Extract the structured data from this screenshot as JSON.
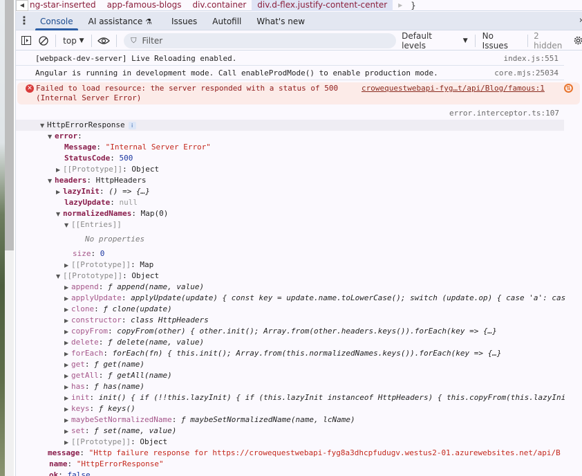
{
  "breadcrumbs": {
    "items": [
      "ng-star-inserted",
      "app-famous-blogs",
      "div.container",
      "div.d-flex.justify-content-center"
    ],
    "selected_index": 3,
    "trailing": "}"
  },
  "tabs": [
    {
      "label": "Console",
      "active": true
    },
    {
      "label": "AI assistance",
      "icon": "flask-icon"
    },
    {
      "label": "Issues"
    },
    {
      "label": "Autofill"
    },
    {
      "label": "What's new"
    }
  ],
  "toolbar": {
    "context": "top",
    "filter_placeholder": "Filter",
    "levels": "Default levels",
    "issues": "No Issues",
    "hidden": "2 hidden"
  },
  "console": {
    "messages": [
      {
        "text": "[webpack-dev-server] Live Reloading enabled.",
        "source": "index.js:551"
      },
      {
        "text": "Angular is running in development mode. Call enableProdMode() to enable production mode.",
        "source": "core.mjs:25034"
      }
    ],
    "error": {
      "line1": "Failed to load resource: the server responded with a status of 500",
      "line2": "(Internal Server Error)",
      "link": "crowequestwebapi-fyg…t/api/Blog/famous:1"
    },
    "log_source": "error.interceptor.ts:107",
    "tree": {
      "root": "HttpErrorResponse",
      "error_key": "error",
      "message_key": "Message",
      "message_val": "\"Internal Server Error\"",
      "status_key": "StatusCode",
      "status_val": "500",
      "proto_key": "[[Prototype]]",
      "proto_object": "Object",
      "proto_map": "Map",
      "headers_key": "headers",
      "headers_val": "HttpHeaders",
      "lazyinit_key": "lazyInit",
      "lazyinit_val": "() => {…}",
      "lazyupdate_key": "lazyUpdate",
      "lazyupdate_val": "null",
      "normnames_key": "normalizedNames",
      "normnames_val": "Map(0)",
      "entries_key": "[[Entries]]",
      "no_props": "No properties",
      "size_key": "size",
      "size_val": "0",
      "methods": [
        {
          "key": "append",
          "val": "ƒ append(name, value)"
        },
        {
          "key": "applyUpdate",
          "val": "applyUpdate(update) { const key = update.name.toLowerCase(); switch (update.op) { case 'a': cas"
        },
        {
          "key": "clone",
          "val": "ƒ clone(update)"
        },
        {
          "key": "constructor",
          "val": "class HttpHeaders"
        },
        {
          "key": "copyFrom",
          "val": "copyFrom(other) { other.init(); Array.from(other.headers.keys()).forEach(key => {…}"
        },
        {
          "key": "delete",
          "val": "ƒ delete(name, value)"
        },
        {
          "key": "forEach",
          "val": "forEach(fn) { this.init(); Array.from(this.normalizedNames.keys()).forEach(key => {…}"
        },
        {
          "key": "get",
          "val": "ƒ get(name)"
        },
        {
          "key": "getAll",
          "val": "ƒ getAll(name)"
        },
        {
          "key": "has",
          "val": "ƒ has(name)"
        },
        {
          "key": "init",
          "val": "init() { if (!!this.lazyInit) { if (this.lazyInit instanceof HttpHeaders) { this.copyFrom(this.lazyIni"
        },
        {
          "key": "keys",
          "val": "ƒ keys()"
        },
        {
          "key": "maybeSetNormalizedName",
          "val": "ƒ maybeSetNormalizedName(name, lcName)"
        },
        {
          "key": "set",
          "val": "ƒ set(name, value)"
        }
      ],
      "msg_key": "message",
      "msg_val": "\"Http failure response for https://crowequestwebapi-fyg8a3dhcpfudugv.westus2-01.azurewebsites.net/api/B",
      "name_key": "name",
      "name_val": "\"HttpErrorResponse\"",
      "ok_key": "ok",
      "ok_val": "false"
    }
  }
}
